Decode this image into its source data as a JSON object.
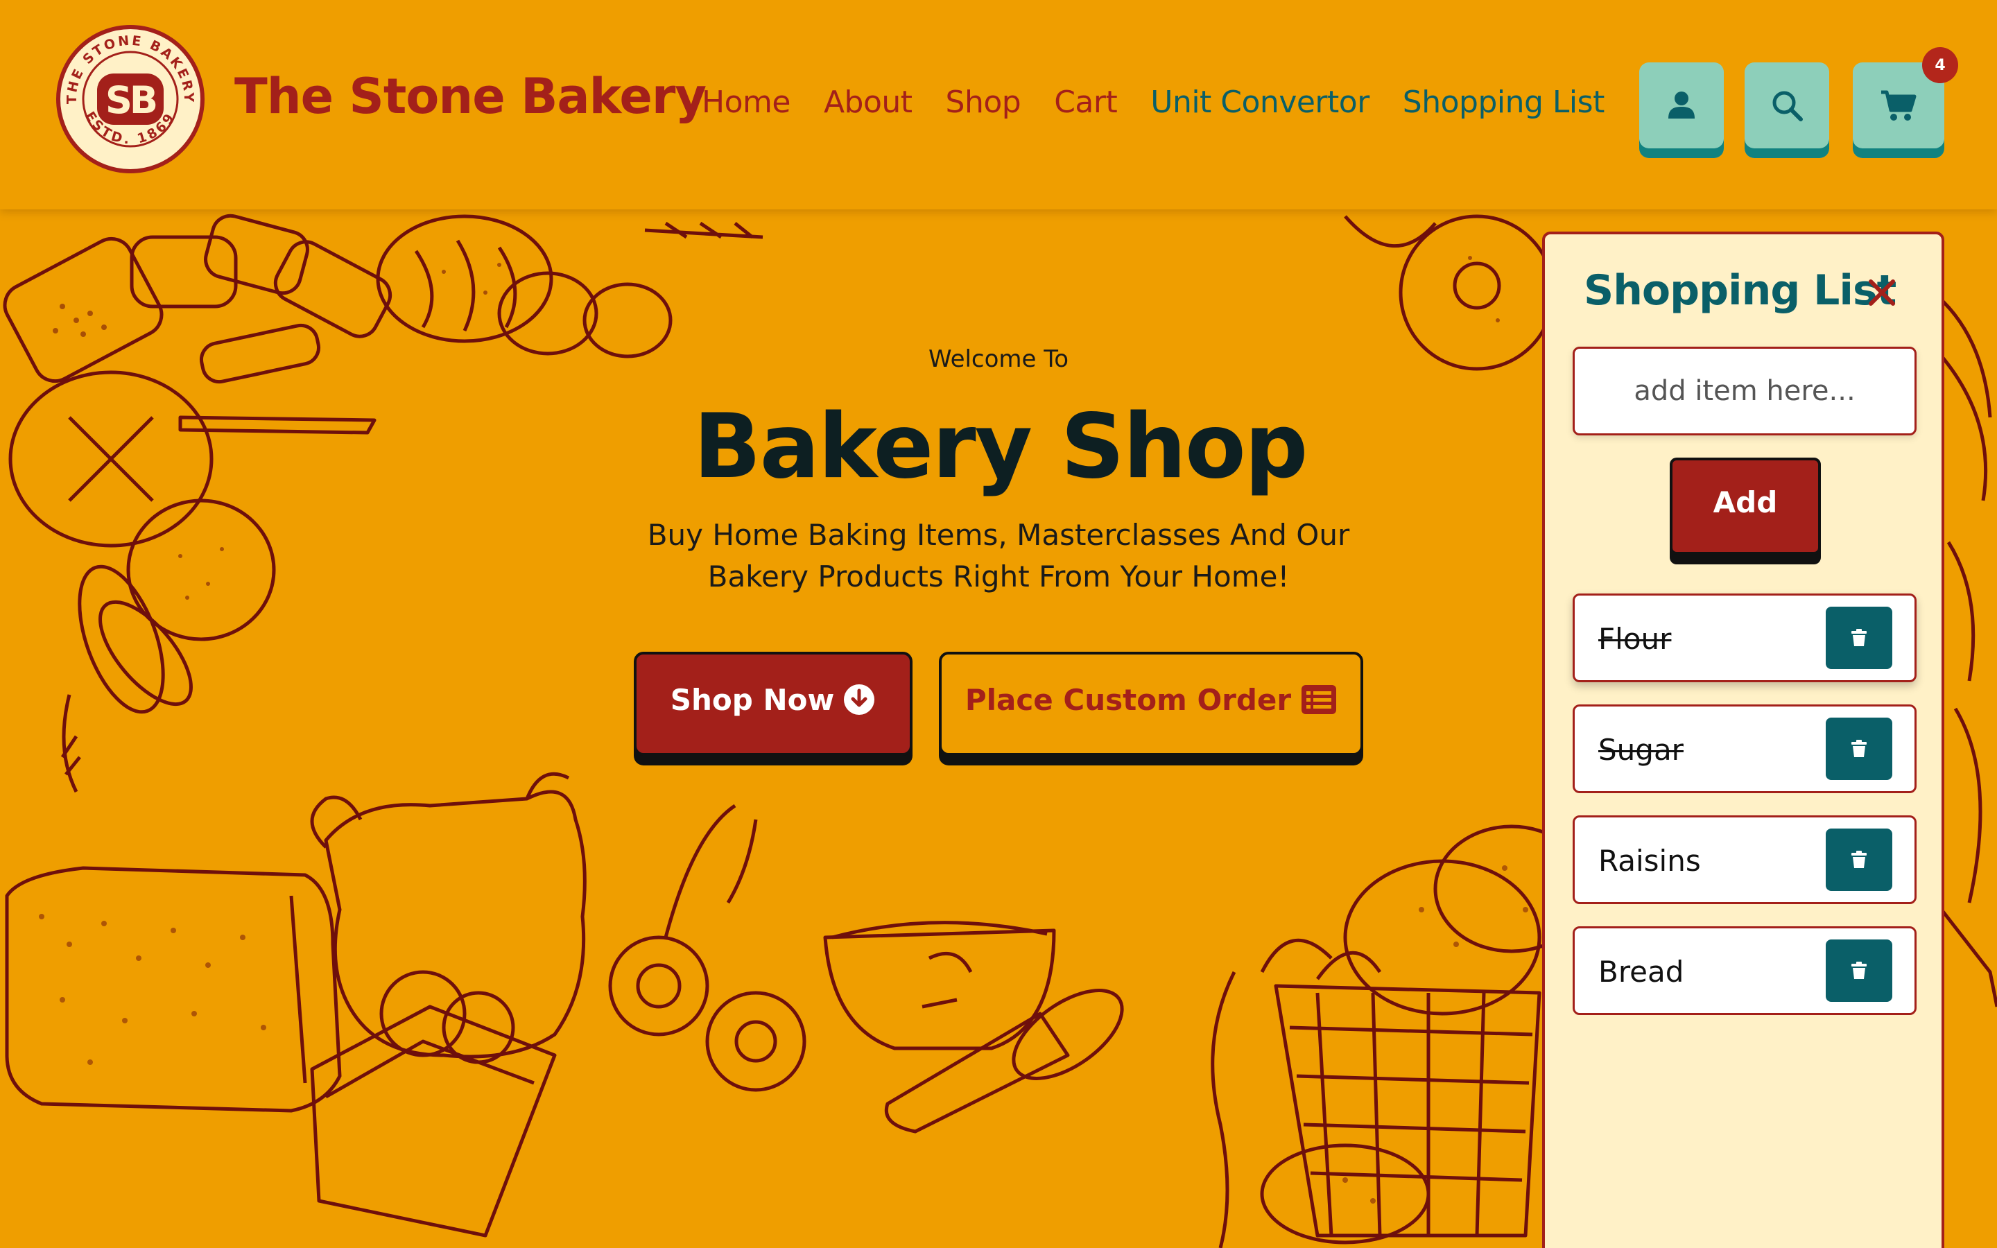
{
  "brand": {
    "name": "The Stone Bakery",
    "logo_ring_top": "THE STONE BAKERY",
    "logo_ring_bottom": "ESTD. 1869",
    "logo_monogram": "SB"
  },
  "nav": {
    "items": [
      {
        "label": "Home",
        "color": "#a3201a"
      },
      {
        "label": "About",
        "color": "#a3201a"
      },
      {
        "label": "Shop",
        "color": "#a3201a"
      },
      {
        "label": "Cart",
        "color": "#a3201a"
      },
      {
        "label": "Unit Convertor",
        "color": "#0a5f68"
      },
      {
        "label": "Shopping List",
        "color": "#0a5f68"
      }
    ]
  },
  "header_actions": {
    "account_icon": "user-icon",
    "search_icon": "search-icon",
    "cart_icon": "cart-icon",
    "cart_count": "4"
  },
  "hero": {
    "welcome": "Welcome To",
    "title": "Bakery Shop",
    "subtitle_line1": "Buy Home Baking Items, Masterclasses And Our",
    "subtitle_line2": "Bakery Products Right From Your Home!",
    "shop_now_label": "Shop Now",
    "shop_now_icon": "arrow-circle-down-icon",
    "custom_order_label": "Place Custom Order",
    "custom_order_icon": "list-icon"
  },
  "shopping_list": {
    "title": "Shopping List",
    "close_icon": "close-icon",
    "input_placeholder": "add item here...",
    "add_label": "Add",
    "items": [
      {
        "name": "Flour",
        "done": true
      },
      {
        "name": "Sugar",
        "done": true
      },
      {
        "name": "Raisins",
        "done": false
      },
      {
        "name": "Bread",
        "done": false
      }
    ]
  },
  "colors": {
    "background": "#ef9e00",
    "brand_red": "#a3201a",
    "teal": "#0a5f68",
    "mint": "#8dcfba",
    "panel_bg": "#fff1c7",
    "illustration_ink": "#6e0f0c"
  }
}
